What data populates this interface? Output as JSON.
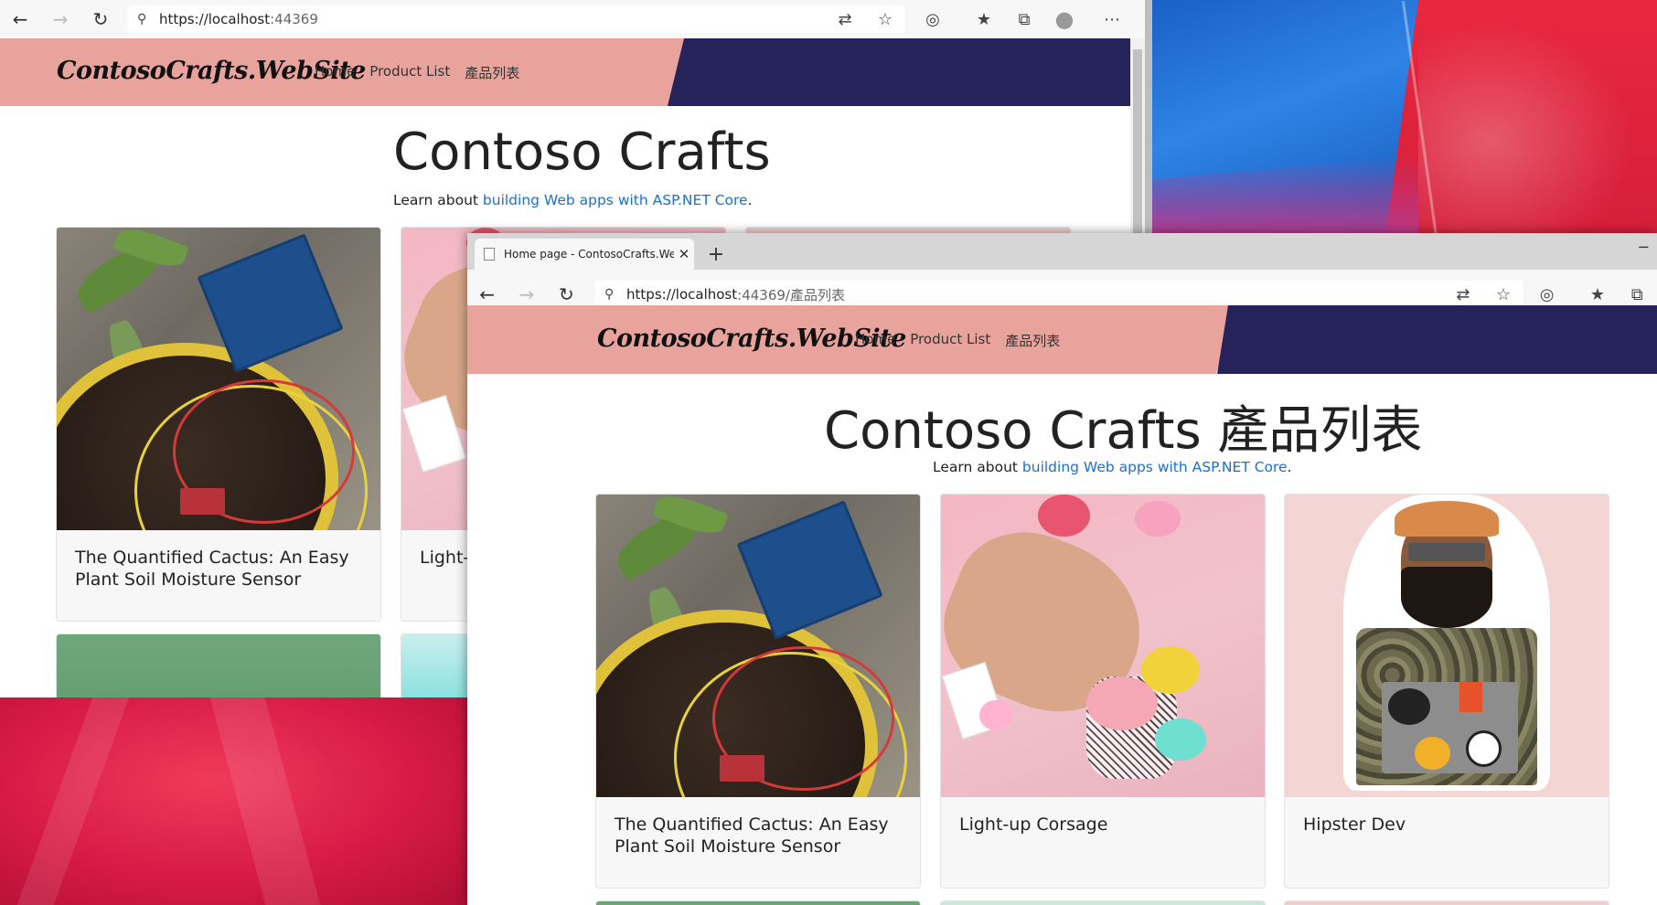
{
  "browser_back": {
    "url": {
      "scheme_host": "https://localhost",
      "port": ":44369"
    },
    "site": {
      "brand": "ContosoCrafts.WebSite",
      "nav": [
        "Home",
        "Product List",
        "產品列表"
      ],
      "heading": "Contoso Crafts",
      "lead_prefix": "Learn about ",
      "lead_link": "building Web apps with ASP.NET Core",
      "lead_suffix": "."
    },
    "cards": [
      {
        "title": "The Quantified Cactus: An Easy Plant Soil Moisture Sensor"
      },
      {
        "title": "Light-"
      }
    ]
  },
  "browser_front": {
    "tab": {
      "title": "Home page - ContosoCrafts.WebSite",
      "close": "✕"
    },
    "newtab": "+",
    "url": {
      "scheme_host": "https://localhost",
      "path": ":44369/產品列表"
    },
    "site": {
      "brand": "ContosoCrafts.WebSite",
      "nav": [
        "Home",
        "Product List",
        "產品列表"
      ],
      "heading": "Contoso Crafts 產品列表",
      "lead_prefix": "Learn about ",
      "lead_link": "building Web apps with ASP.NET Core",
      "lead_suffix": "."
    },
    "cards": [
      {
        "title": "The Quantified Cactus: An Easy Plant Soil Moisture Sensor"
      },
      {
        "title": "Light-up Corsage"
      },
      {
        "title": "Hipster Dev"
      }
    ]
  },
  "icons": {
    "back": "←",
    "forward": "→",
    "refresh": "↻",
    "lock": "🔒",
    "translate": "⇄",
    "favorite": "☆",
    "reading": "◎",
    "favorites": "★",
    "collections": "⧉",
    "profile": "●",
    "more": "⋯",
    "minimize": "─"
  },
  "colors": {
    "nav_pink": "#e9a39d",
    "nav_navy": "#25235a",
    "link_blue": "#1a6fd1"
  }
}
